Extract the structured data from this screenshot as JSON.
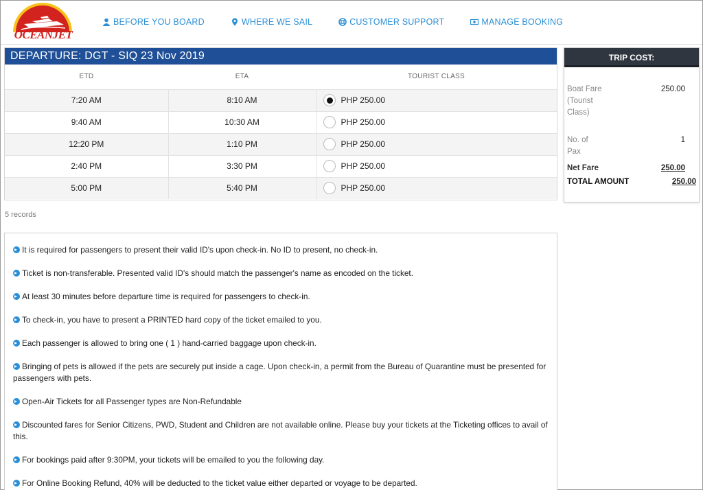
{
  "header": {
    "logo_text": "OCEANJET",
    "nav": [
      {
        "label": "BEFORE YOU BOARD",
        "icon": "user-icon"
      },
      {
        "label": "WHERE WE SAIL",
        "icon": "map-pin-icon"
      },
      {
        "label": "CUSTOMER SUPPORT",
        "icon": "lifebuoy-icon"
      },
      {
        "label": "MANAGE BOOKING",
        "icon": "ticket-icon"
      }
    ]
  },
  "departure": {
    "title": "DEPARTURE: DGT - SIQ 23 Nov 2019",
    "columns": [
      "ETD",
      "ETA",
      "TOURIST CLASS"
    ],
    "rows": [
      {
        "etd": "7:20 AM",
        "eta": "8:10 AM",
        "fare": "PHP 250.00",
        "selected": true
      },
      {
        "etd": "9:40 AM",
        "eta": "10:30 AM",
        "fare": "PHP 250.00",
        "selected": false
      },
      {
        "etd": "12:20 PM",
        "eta": "1:10 PM",
        "fare": "PHP 250.00",
        "selected": false
      },
      {
        "etd": "2:40 PM",
        "eta": "3:30 PM",
        "fare": "PHP 250.00",
        "selected": false
      },
      {
        "etd": "5:00 PM",
        "eta": "5:40 PM",
        "fare": "PHP 250.00",
        "selected": false
      }
    ],
    "records": "5 records"
  },
  "trip_cost": {
    "title": "TRIP COST:",
    "boat_fare_label": "Boat Fare (Tourist Class)",
    "boat_fare_value": "250.00",
    "pax_label": "No. of Pax",
    "pax_value": "1",
    "net_fare_label": "Net Fare",
    "net_fare_value": "250.00",
    "total_label": "TOTAL AMOUNT",
    "total_value": "250.00"
  },
  "notes": [
    "It is required for passengers to present their valid ID's upon check-in. No ID to present, no check-in.",
    "Ticket is non-transferable. Presented valid ID's should match the passenger's name as encoded on the ticket.",
    "At least 30 minutes before departure time is required for passengers to check-in.",
    "To check-in, you have to present a PRINTED hard copy of the ticket emailed to you.",
    "Each passenger is allowed to bring one ( 1 ) hand-carried baggage upon check-in.",
    "Bringing of pets is allowed if the pets are securely put inside a cage. Upon check-in, a permit from the Bureau of Quarantine must be presented for passengers with pets.",
    "Open-Air Tickets for all Passenger types are Non-Refundable",
    "Discounted fares for Senior Citizens, PWD, Student and Children are not available online. Please buy your tickets at the Ticketing offices to avail of this.",
    "For bookings paid after 9:30PM, your tickets will be emailed to you the following day.",
    "For Online Booking Refund, 40% will be deducted to the ticket value either departed or voyage to be departed."
  ],
  "colors": {
    "brand_red": "#d2231f",
    "brand_yellow": "#f7c21b",
    "nav_blue": "#2a8fd6",
    "header_blue": "#1f4f96",
    "trip_head": "#2f3640"
  }
}
